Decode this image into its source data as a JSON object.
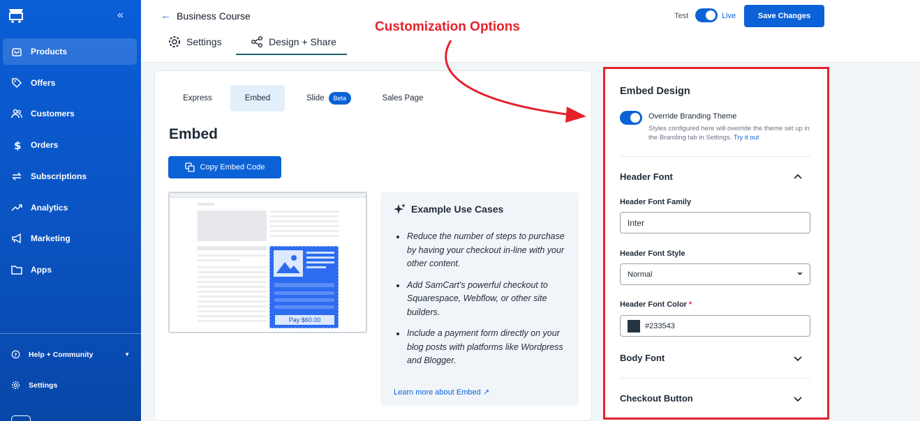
{
  "sidebar": {
    "items": [
      {
        "label": "Products",
        "icon": "bag-icon",
        "active": true
      },
      {
        "label": "Offers",
        "icon": "tag-icon"
      },
      {
        "label": "Customers",
        "icon": "users-icon"
      },
      {
        "label": "Orders",
        "icon": "dollar-icon"
      },
      {
        "label": "Subscriptions",
        "icon": "repeat-icon"
      },
      {
        "label": "Analytics",
        "icon": "trend-icon"
      },
      {
        "label": "Marketing",
        "icon": "megaphone-icon"
      },
      {
        "label": "Apps",
        "icon": "folder-icon"
      }
    ],
    "help_label": "Help + Community",
    "settings_label": "Settings"
  },
  "header": {
    "course_title": "Business Course",
    "tabs": [
      {
        "label": "Settings"
      },
      {
        "label": "Design + Share",
        "active": true
      }
    ],
    "test_label": "Test",
    "live_label": "Live",
    "save_label": "Save Changes"
  },
  "annotation": {
    "text": "Customization Options",
    "color": "#e5222b"
  },
  "main": {
    "subtabs": [
      {
        "label": "Express"
      },
      {
        "label": "Embed",
        "active": true
      },
      {
        "label": "Slide",
        "badge": "Beta"
      },
      {
        "label": "Sales Page"
      }
    ],
    "heading": "Embed",
    "copy_button": "Copy Embed Code",
    "mock_pay_label": "Pay $60.00",
    "examples": {
      "title": "Example Use Cases",
      "items": [
        "Reduce the number of steps to purchase by having your checkout in-line with your other content.",
        "Add SamCart's powerful checkout to Squarespace, Webflow, or other site builders.",
        "Include a payment form directly on your blog posts with platforms like Wordpress and Blogger."
      ],
      "learn_more": "Learn more about Embed"
    }
  },
  "panel": {
    "title": "Embed Design",
    "override_label": "Override Branding Theme",
    "override_desc": "Styles configured here will override the theme set up in the Branding tab in Settings.",
    "try_link": "Try it out",
    "header_font": {
      "title": "Header Font",
      "family_label": "Header Font Family",
      "family_value": "Inter",
      "style_label": "Header Font Style",
      "style_value": "Normal",
      "color_label": "Header Font Color",
      "color_required": "*",
      "color_value": "#233543"
    },
    "body_font_title": "Body Font",
    "checkout_button_title": "Checkout Button"
  },
  "colors": {
    "primary": "#0b62d6",
    "sidebar": "#0b5ed7",
    "swatch": "#233543"
  }
}
